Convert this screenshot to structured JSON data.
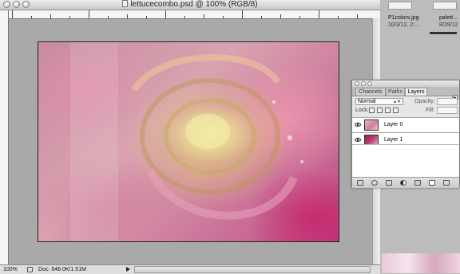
{
  "document": {
    "title": "lettucecombo.psd @ 100% (RGB/8)",
    "zoom": "100%",
    "doc_info": "Doc: 648.0K/1.51M"
  },
  "desktop": {
    "files": [
      {
        "name": "P1colors.jpg",
        "date": "10/3/12, 2:..."
      },
      {
        "name": "palett...",
        "date": "8/29/12"
      }
    ]
  },
  "layers_panel": {
    "tabs": [
      "Channels",
      "Paths",
      "Layers"
    ],
    "active_tab": "Layers",
    "blend_mode": "Normal",
    "opacity_label": "Opacity:",
    "lock_label": "Lock:",
    "fill_label": "Fill:",
    "layers": [
      {
        "name": "Layer 0",
        "visible": true,
        "selected": false
      },
      {
        "name": "Layer 1",
        "visible": true,
        "selected": false
      }
    ],
    "footer_icons": [
      "link-icon",
      "fx-icon",
      "mask-icon",
      "adjustment-icon",
      "group-icon",
      "new-layer-icon",
      "trash-icon"
    ]
  },
  "colors": {
    "canvas_dark_pink": "#b83a7a",
    "canvas_yellow": "#f5f0a0",
    "workspace_gray": "#a9a9a9"
  }
}
